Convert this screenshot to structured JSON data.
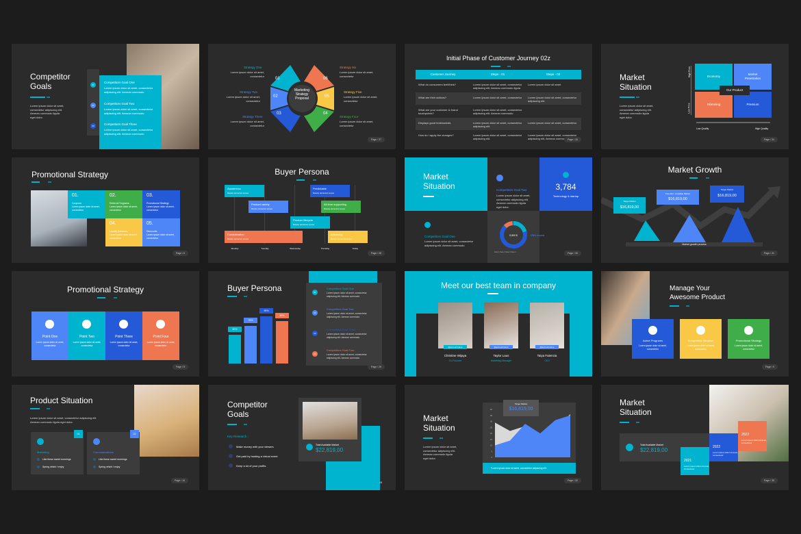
{
  "colors": {
    "background": "#1c1c1c",
    "slide": "#2b2b2b",
    "cyan": "#00b4d0",
    "blue": "#4f86f7",
    "dark_blue": "#2459d8",
    "green": "#3fae49",
    "yellow": "#f9c846",
    "orange": "#ee7651"
  },
  "lorem": {
    "short": "Lorem ipsum dolor sit amet,\nconsectetur",
    "para": "Lorem ipsum dolor sit amet,\nconsectetur adipiscing elit.\nAenean commodo ligula\neget dolor.",
    "two": "Lorem ipsum dolor sit amet, consectetur\nadipiscing elit. Aenean commodo"
  },
  "s1": {
    "title": "Competitor\nGoals",
    "goals": [
      {
        "n": "01",
        "title": "Competitors Goal One"
      },
      {
        "n": "02",
        "title": "Competitors Goal Two"
      },
      {
        "n": "03",
        "title": "Competitors Goal Three"
      }
    ]
  },
  "s2": {
    "center": "Marketing\nStrategy\nProposal",
    "segments": [
      "01",
      "02",
      "03",
      "04",
      "05",
      "06"
    ],
    "labels": [
      "Strategy One",
      "Strategy Two",
      "Strategy Three",
      "Strategy Four",
      "Strategy Five",
      "Strategy Six"
    ],
    "page": "Page / 27"
  },
  "s3": {
    "title": "Initial Phase of Customer Journey 02z",
    "headers": [
      "Customer Journey",
      "Steps - 01",
      "Steps - 02"
    ],
    "rows": [
      [
        "What do consumers feel/think?",
        "Lorem ipsum dolor sit amet, consectetur\nadipiscing elit. Aenean commodo ligula",
        "Lorem ipsum dolor sit amet"
      ],
      [
        "What are their actions?",
        "Lorem ipsum dolor sit amet, consectetur",
        "Lorem ipsum dolor sit amet, consectetur\nadipiscing elit."
      ],
      [
        "What are your customer & brand\ntouchpoints?",
        "Lorem ipsum dolor sit amet, consectetur\nadipiscing elit. Aenean commodo",
        ""
      ],
      [
        "Displays good testimonials",
        "Lorem ipsum dolor sit amet, consectetur\nadipiscing elit.",
        "Lorem ipsum dolor sit amet, consectetur"
      ],
      [
        "How do I apply the changes?",
        "Lorem ipsum dolor sit amet, consectetur\nadipiscing elit.",
        "Lorem ipsum dolor sit amet, consectetur\nadipiscing elit. Aenean commodo"
      ]
    ],
    "page": "Page / 33"
  },
  "s4": {
    "title": "Market\nSituation",
    "quadrants": [
      "Economy",
      "Market\nPenetration",
      "Skimming",
      "Premium"
    ],
    "center": "Our Product",
    "y_high": "High Price",
    "y_low": "Low Price",
    "x_low": "Low Quality",
    "x_high": "High Quality",
    "page": "Page / 34"
  },
  "s5": {
    "title": "Promotional Strategy",
    "tiles": [
      {
        "n": "01.",
        "label": "Coupons"
      },
      {
        "n": "02.",
        "label": "Referral Programs"
      },
      {
        "n": "03.",
        "label": "Promotional Strategy"
      },
      {
        "n": "04.",
        "label": "Loyalty Schemes"
      },
      {
        "n": "05.",
        "label": "Discounts"
      }
    ],
    "page": "Page / 6"
  },
  "s6": {
    "title": "Buyer Persona",
    "bars": [
      {
        "label": "Awareness"
      },
      {
        "label": "Predictable"
      },
      {
        "label": "Product variety"
      },
      {
        "label": "All time supporting"
      },
      {
        "label": "Product lifecycle"
      },
      {
        "label": "Consideration"
      },
      {
        "label": "Advocacy"
      }
    ],
    "sub": "Massive elementum semper",
    "days": [
      "Monday",
      "Tuesday",
      "Wednesday",
      "Thursday",
      "Friday"
    ],
    "page": "Page / 28"
  },
  "s7": {
    "title": "Market\nSituation",
    "goal_two": "Competitors Goal Two",
    "goal_one": "Competitors Goal One",
    "stat": "3,784",
    "stat_label": "Technology & startup",
    "donut_center": "5,800 $",
    "growth": "+28% Income",
    "legend": [
      "Data 1",
      "Data 2",
      "Data 3",
      "Data 4"
    ],
    "page": "Page / 30"
  },
  "s8": {
    "title": "Market Growth",
    "callouts": [
      {
        "label": "Target Market",
        "value": "$16,819,00"
      },
      {
        "label": "Potential - Available Market",
        "value": "$16,819,00"
      },
      {
        "label": "Target Market",
        "value": "$16,819,00"
      }
    ],
    "process": "Market growth process",
    "page": "Page / 31"
  },
  "s9": {
    "title": "Promotional Strategy",
    "cards": [
      "Point One",
      "Point Two",
      "Point Three",
      "Point Four"
    ],
    "page": "Page / 8"
  },
  "s10": {
    "title": "Buyer Persona",
    "bars": [
      {
        "label": "60%",
        "value": 60
      },
      {
        "label": "78%",
        "value": 78
      },
      {
        "label": "99%",
        "value": 99
      },
      {
        "label": "89%",
        "value": 89
      }
    ],
    "goals": [
      {
        "n": "01",
        "title": "Competitors Goal One"
      },
      {
        "n": "02",
        "title": "Competitors Goal Two"
      },
      {
        "n": "03",
        "title": "Competitors Goal Three"
      },
      {
        "n": "04",
        "title": "Competitors Goal Four"
      }
    ],
    "page": "Page / 29"
  },
  "s11": {
    "title": "Meet our best team in company",
    "handle": "@accountname",
    "members": [
      {
        "name": "Christine Wijaya",
        "role": "Co-Founder"
      },
      {
        "name": "Taylor Laus",
        "role": "Marketing Manager"
      },
      {
        "name": "Taiya Faiencia",
        "role": "CEO"
      }
    ]
  },
  "s12": {
    "title": "Manage Your\nAwesome Product",
    "cards": [
      "Active Programs",
      "Competitive Situation",
      "Promotional Strategy"
    ],
    "page": "Page / 9"
  },
  "s13": {
    "title": "Product Situation",
    "intro": "Lorem ipsum dolor sit amet, consectetur adipiscing elit.\nAenean commodo ligula eget dolor.",
    "cards": [
      {
        "n": "01",
        "title": "Marketing"
      },
      {
        "n": "02",
        "title": "Communications"
      }
    ],
    "bullets": [
      "Like these sweet mornings",
      "Spring which I enjoy"
    ],
    "page": "Page / 15"
  },
  "s14": {
    "title": "Competitor\nGoals",
    "key": "Key Research :",
    "items": [
      "Make money with your viewers",
      "Get paid by hosting a virtual event",
      "Keep a lot of your profits"
    ],
    "card_label": "Total Available Market",
    "card_value": "$22,819,00",
    "page": "15"
  },
  "s15": {
    "title": "Market\nSituation",
    "tooltip_label": "Target Market",
    "tooltip_value": "$16,819,00",
    "footnote": "*Lorem ipsum dolor sit amet, consectetur adipiscing elit.",
    "page": "Page / 32",
    "chart_data": {
      "type": "area",
      "yticks": [
        0,
        5,
        10,
        15,
        20,
        25,
        30,
        35,
        40
      ],
      "ylim": [
        0,
        40
      ],
      "series": [
        {
          "values": [
            29,
            22,
            26,
            18,
            24,
            36
          ]
        },
        {
          "values": [
            10,
            14,
            28,
            20,
            31,
            35
          ]
        }
      ]
    }
  },
  "s16": {
    "title": "Market\nSituation",
    "card_label": "Total Available Market",
    "card_value": "$22,819,00",
    "years": [
      "2021",
      "2022",
      "2023"
    ],
    "page": "Page / 35"
  }
}
